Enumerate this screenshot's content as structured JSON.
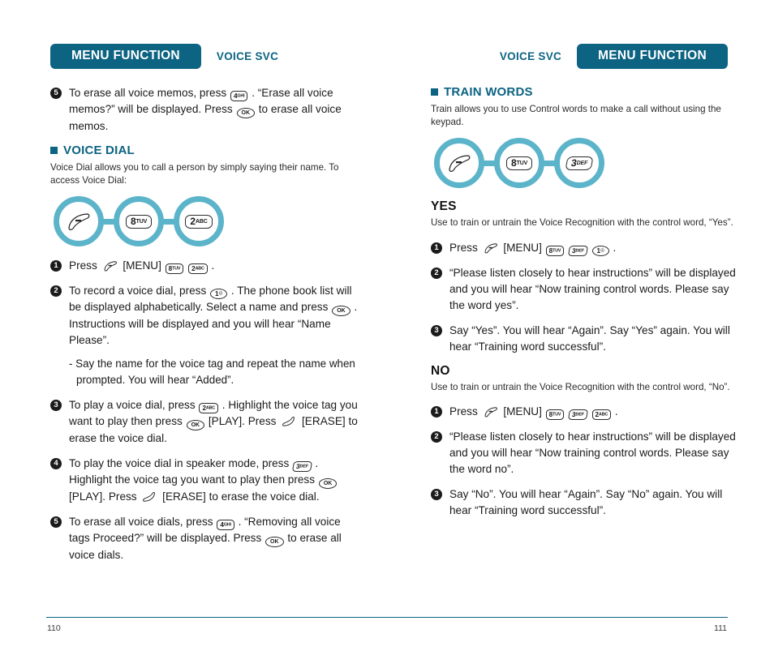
{
  "header": {
    "left": {
      "pill_label": "MENU FUNCTION",
      "sub_label": "VOICE SVC"
    },
    "right": {
      "pill_label": "MENU FUNCTION",
      "sub_label": "VOICE SVC"
    }
  },
  "footer": {
    "page_left": "110",
    "page_right": "111"
  },
  "left_column": {
    "continued_step": {
      "number": "5",
      "text_a": "To erase all voice memos, press",
      "key_1": {
        "digit": "4",
        "letters": "GHI"
      },
      "text_b": ". “Erase all voice memos?” will be displayed. Press",
      "key_ok": "OK",
      "text_c": "to erase all voice memos."
    },
    "voice_dial": {
      "heading": "VOICE DIAL",
      "description": "Voice Dial allows you to call a person by simply saying their name. To access Voice Dial:",
      "flow": [
        {
          "type": "menu-key-icon",
          "label": "MENU"
        },
        {
          "type": "keypad",
          "digit": "8",
          "letters": "TUV"
        },
        {
          "type": "keypad",
          "digit": "2",
          "letters": "ABC"
        }
      ],
      "steps": [
        {
          "number": "1",
          "text_a": "Press",
          "menu_label": "[MENU]",
          "key_1": {
            "digit": "8",
            "letters": "TUV"
          },
          "key_2": {
            "digit": "2",
            "letters": "ABC"
          },
          "text_b": "."
        },
        {
          "number": "2",
          "text_a": "To record a voice dial, press",
          "key_1": {
            "digit": "1",
            "letters": "☉"
          },
          "text_b": ". The phone book list will be displayed alphabetically. Select a name and press",
          "key_ok": "OK",
          "text_c": ". Instructions will be displayed and you will hear “Name Please”."
        },
        {
          "number": "3",
          "text_a": "To play a voice dial, press",
          "key_1": {
            "digit": "2",
            "letters": "ABC"
          },
          "text_b": ". Highlight the voice tag you want to play then press",
          "key_ok": "OK",
          "text_c": "[PLAY]. Press",
          "text_d": "[ERASE] to erase the voice dial."
        },
        {
          "number": "4",
          "text_a": "To play the voice dial in speaker mode, press",
          "key_1": {
            "digit": "3",
            "letters": "DEF"
          },
          "text_b": ". Highlight the voice tag you want to play then press",
          "key_ok": "OK",
          "text_c": "[PLAY]. Press",
          "text_d": "[ERASE] to erase the voice dial."
        },
        {
          "number": "5",
          "text_a": "To erase all voice dials, press",
          "key_1": {
            "digit": "4",
            "letters": "GHI"
          },
          "text_b": ". “Removing all voice tags Proceed?” will be displayed. Press",
          "key_ok": "OK",
          "text_c": "to erase all voice dials."
        }
      ],
      "sub_note": "- Say the name for the voice tag and repeat the name when prompted. You will hear “Added”."
    }
  },
  "right_column": {
    "train_words": {
      "heading": "TRAIN WORDS",
      "description": "Train allows you to use Control words to make a call without using the keypad.",
      "flow": [
        {
          "type": "menu-key-icon",
          "label": "MENU"
        },
        {
          "type": "keypad",
          "digit": "8",
          "letters": "TUV"
        },
        {
          "type": "keypad",
          "digit": "3",
          "letters": "DEF"
        }
      ]
    },
    "yes": {
      "heading": "YES",
      "description": "Use to train or untrain the Voice Recognition with the control word, “Yes”.",
      "steps": [
        {
          "number": "1",
          "text_a": "Press",
          "menu_label": "[MENU]",
          "key_1": {
            "digit": "8",
            "letters": "TUV"
          },
          "key_2": {
            "digit": "3",
            "letters": "DEF"
          },
          "key_3": {
            "digit": "1",
            "letters": "☉"
          },
          "text_b": "."
        },
        {
          "number": "2",
          "text_a": "“Please listen closely to hear instructions” will be displayed and you will hear “Now training control words. Please say the word yes”."
        },
        {
          "number": "3",
          "text_a": "Say “Yes”. You will hear “Again”. Say “Yes” again. You will hear “Training word successful”."
        }
      ]
    },
    "no": {
      "heading": "NO",
      "description": "Use to train or untrain the Voice Recognition with the control word, “No”.",
      "steps": [
        {
          "number": "1",
          "text_a": "Press",
          "menu_label": "[MENU]",
          "key_1": {
            "digit": "8",
            "letters": "TUV"
          },
          "key_2": {
            "digit": "3",
            "letters": "DEF"
          },
          "key_3": {
            "digit": "2",
            "letters": "ABC"
          },
          "text_b": "."
        },
        {
          "number": "2",
          "text_a": "“Please listen closely to hear instructions” will be displayed and you will hear “Now training control words. Please say the word no”."
        },
        {
          "number": "3",
          "text_a": "Say “No”. You will hear “Again”. Say “No” again. You will hear “Training word successful”."
        }
      ]
    }
  }
}
